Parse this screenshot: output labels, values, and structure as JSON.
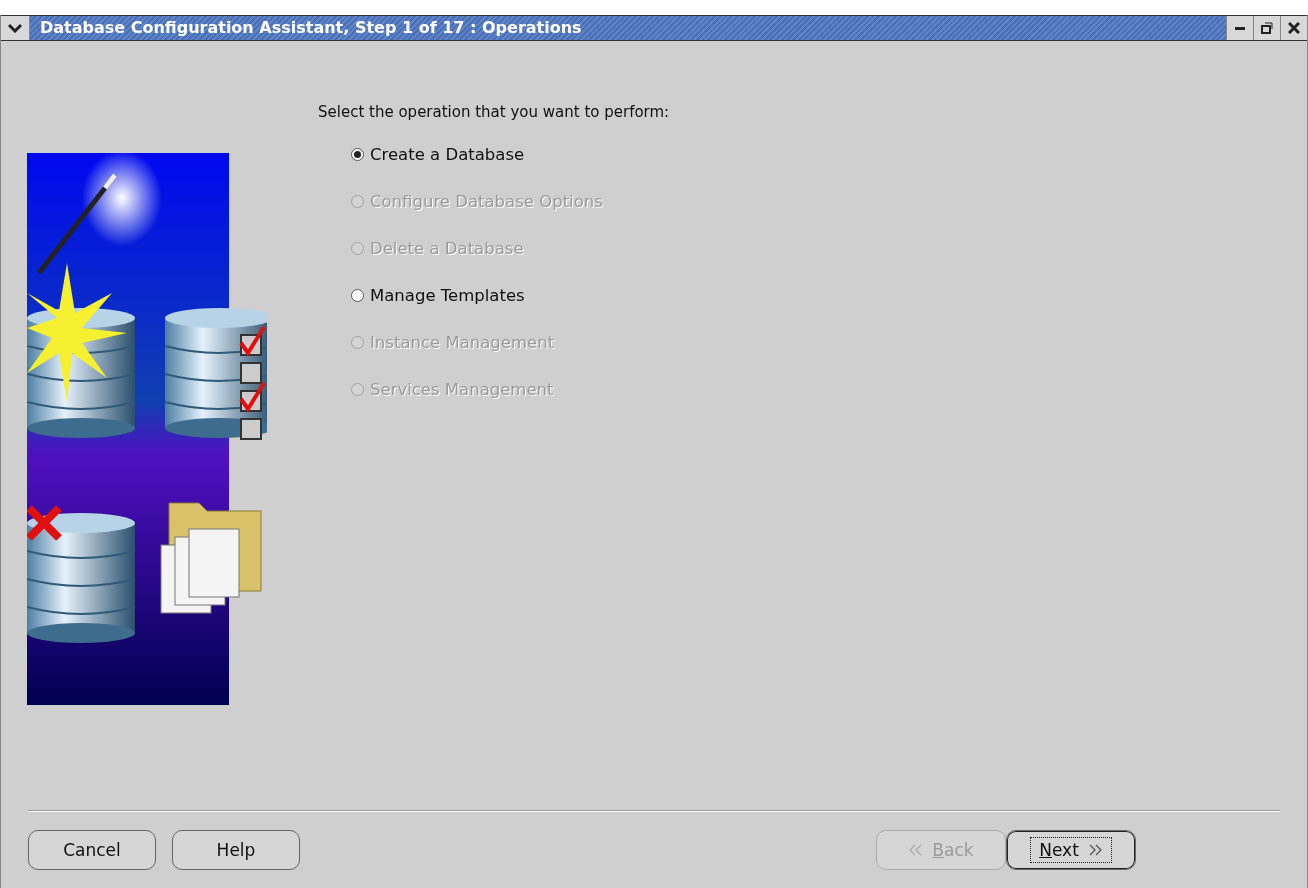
{
  "window": {
    "title": "Database Configuration Assistant, Step 1 of 17 : Operations"
  },
  "prompt": "Select the operation that you want to perform:",
  "operations": [
    {
      "label": "Create a Database",
      "selected": true,
      "disabled": false
    },
    {
      "label": "Configure Database Options",
      "selected": false,
      "disabled": true
    },
    {
      "label": "Delete a Database",
      "selected": false,
      "disabled": true
    },
    {
      "label": "Manage Templates",
      "selected": false,
      "disabled": false
    },
    {
      "label": "Instance Management",
      "selected": false,
      "disabled": true
    },
    {
      "label": "Services Management",
      "selected": false,
      "disabled": true
    }
  ],
  "left_buttons": [
    {
      "label": "Cancel",
      "disabled": false,
      "focused": false,
      "mnemonic": false
    },
    {
      "label": "Help",
      "disabled": false,
      "focused": false,
      "mnemonic": false
    }
  ],
  "right_buttons": [
    {
      "label": "Back",
      "kind": "back",
      "disabled": true,
      "focused": false,
      "mnemonic": true
    },
    {
      "label": "Next",
      "kind": "next",
      "disabled": false,
      "focused": true,
      "mnemonic": true
    }
  ]
}
